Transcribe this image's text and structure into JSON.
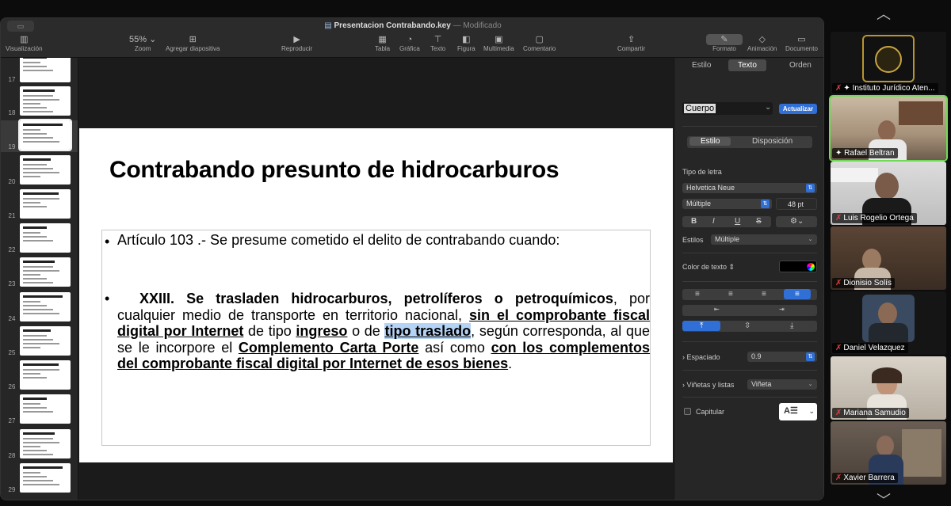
{
  "window": {
    "doc_name": "Presentacion Contrabando.key",
    "doc_status": "Modificado"
  },
  "toolbar": {
    "view": "Visualización",
    "zoom_value": "55%",
    "zoom": "Zoom",
    "add_slide": "Agregar diapositiva",
    "play": "Reproducir",
    "table": "Tabla",
    "chart": "Gráfica",
    "text": "Texto",
    "shape": "Figura",
    "media": "Multimedia",
    "comment": "Comentario",
    "share": "Compartir",
    "format": "Formato",
    "animate": "Animación",
    "document": "Documento"
  },
  "navigator": {
    "slides": [
      {
        "num": "17"
      },
      {
        "num": "18"
      },
      {
        "num": "19"
      },
      {
        "num": "20"
      },
      {
        "num": "21"
      },
      {
        "num": "22"
      },
      {
        "num": "23"
      },
      {
        "num": "24"
      },
      {
        "num": "25"
      },
      {
        "num": "26"
      },
      {
        "num": "27"
      },
      {
        "num": "28"
      },
      {
        "num": "29"
      }
    ]
  },
  "slide": {
    "title": "Contrabando presunto de hidrocarburos",
    "bullet1": "Artículo 103 .- Se presume cometido el delito de contrabando cuando:",
    "b2_part1": "XXIII. Se trasladen hidrocarburos, petrolíferos o petroquímicos",
    "b2_part2": ", por cualquier medio de transporte en territorio nacional, ",
    "b2_part3": "sin el comprobante fiscal digital por Internet",
    "b2_part4": " de tipo ",
    "b2_part5": "ingreso",
    "b2_part6": " o de ",
    "b2_part7": "tipo traslado",
    "b2_part8": ", según corresponda, al que se le incorpore el ",
    "b2_part9": "Complemento Carta Porte",
    "b2_part10": " así como ",
    "b2_part11": "con los complementos del comprobante fiscal digital por Internet de esos bienes",
    "b2_part12": "."
  },
  "inspector": {
    "tab_style": "Estilo",
    "tab_text": "Texto",
    "tab_order": "Orden",
    "paragraph_style": "Cuerpo",
    "update": "Actualizar",
    "sub_style": "Estilo",
    "sub_layout": "Disposición",
    "font_label": "Tipo de letra",
    "font_value": "Helvetica Neue",
    "weight_value": "Múltiple",
    "size_value": "48 pt",
    "styles_label": "Estilos",
    "styles_value": "Múltiple",
    "color_label": "Color de texto",
    "spacing_label": "Espaciado",
    "spacing_value": "0.9",
    "bullets_label": "Viñetas y listas",
    "bullets_value": "Viñeta",
    "dropcap_label": "Capitular"
  },
  "participants": [
    {
      "name": "Instituto Jurídico Aten..."
    },
    {
      "name": "Rafael Beltran"
    },
    {
      "name": "Luis Rogelio Ortega"
    },
    {
      "name": "Dionisio Solís"
    },
    {
      "name": "Daniel Velazquez"
    },
    {
      "name": "Mariana Samudio"
    },
    {
      "name": "Xavier Barrera"
    }
  ],
  "colors": {
    "accent": "#2f6fd6",
    "speaking": "#6fdb55",
    "highlight": "#b5d3f5"
  }
}
